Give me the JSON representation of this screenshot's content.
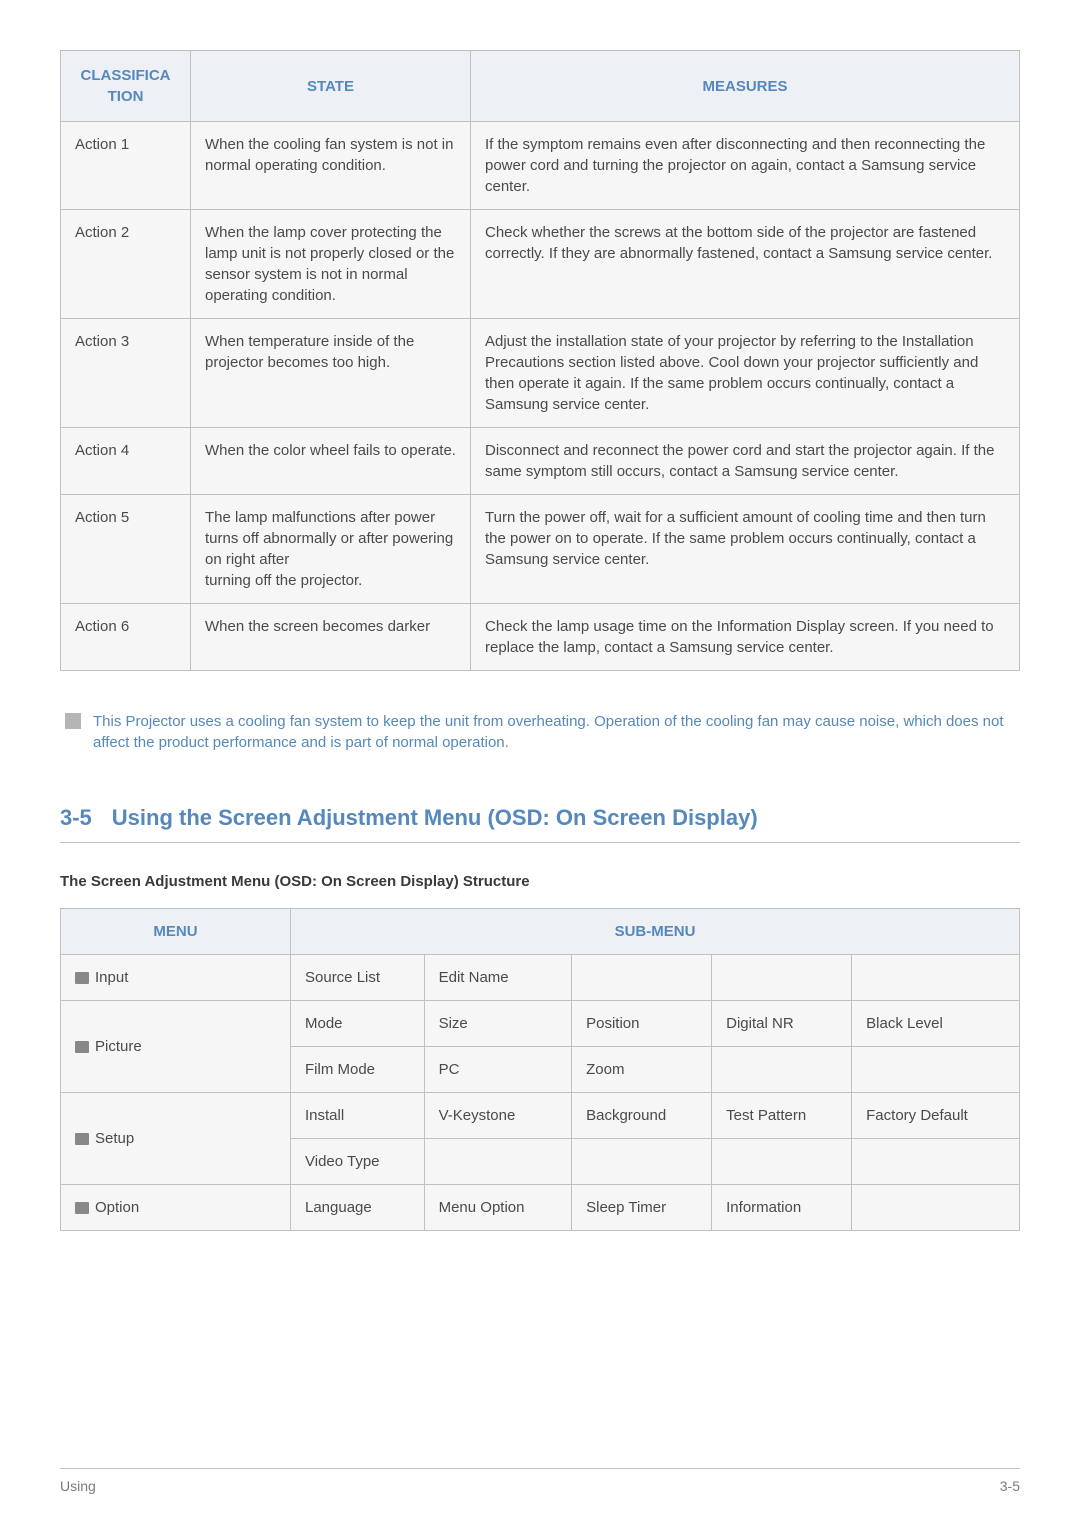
{
  "table1": {
    "headers": {
      "classification": "CLASSIFICA\nTION",
      "state": "STATE",
      "measures": "MEASURES"
    },
    "rows": [
      {
        "c": "Action 1",
        "s": "When the cooling fan system is not in normal operating condition.",
        "m": "If the symptom remains even after disconnecting and then reconnecting the power cord and turning the projector on again, contact a Samsung service center."
      },
      {
        "c": "Action 2",
        "s": "When the lamp cover protecting the lamp unit is not properly closed or the sensor system is not in normal operating condition.",
        "m": "Check whether the screws at the bottom side of the projector are fastened correctly. If they are abnormally fastened, contact a Samsung service center."
      },
      {
        "c": "Action 3",
        "s": "When temperature inside of the projector becomes too high.",
        "m": "Adjust the installation state of your projector by referring to the Installation Precautions section listed above. Cool down your projector sufficiently and then operate it again. If the same problem occurs continually, contact a Samsung service center."
      },
      {
        "c": "Action 4",
        "s": "When the color wheel fails to operate.",
        "m": "Disconnect and reconnect the power cord and start the projector again. If the same symptom still occurs, contact a Samsung service center."
      },
      {
        "c": "Action 5",
        "s": "The lamp malfunctions after power turns off abnormally or after powering on right after\nturning off the projector.",
        "m": "Turn the power off, wait for a sufficient amount of cooling time and then turn the power on to operate. If the same problem occurs continually, contact a Samsung service center."
      },
      {
        "c": "Action 6",
        "s": "When the screen becomes darker",
        "m": "Check the lamp usage time on the Information Display screen. If you need to replace the lamp, contact a Samsung service center."
      }
    ]
  },
  "note": "This Projector uses a cooling fan system to keep the unit from overheating. Operation of the cooling fan may cause noise, which does not affect the product performance and is part of normal operation.",
  "section": {
    "number": "3-5",
    "title": "Using the Screen Adjustment Menu (OSD: On Screen Display)"
  },
  "structure_title": "The Screen Adjustment Menu (OSD: On Screen Display) Structure",
  "table2": {
    "headers": {
      "menu": "MENU",
      "submenu": "SUB-MENU"
    },
    "menus": {
      "input": "Input",
      "picture": "Picture",
      "setup": "Setup",
      "option": "Option"
    },
    "cells": {
      "source_list": "Source List",
      "edit_name": "Edit Name",
      "mode": "Mode",
      "size": "Size",
      "position": "Position",
      "digital_nr": "Digital NR",
      "black_level": "Black Level",
      "film_mode": "Film Mode",
      "pc": "PC",
      "zoom": "Zoom",
      "install": "Install",
      "vkeystone": "V-Keystone",
      "background": "Background",
      "test_pattern": "Test Pattern",
      "factory_default": "Factory Default",
      "video_type": "Video Type",
      "language": "Language",
      "menu_option": "Menu Option",
      "sleep_timer": "Sleep Timer",
      "information": "Information"
    }
  },
  "footer": {
    "left": "Using",
    "right": "3-5"
  }
}
